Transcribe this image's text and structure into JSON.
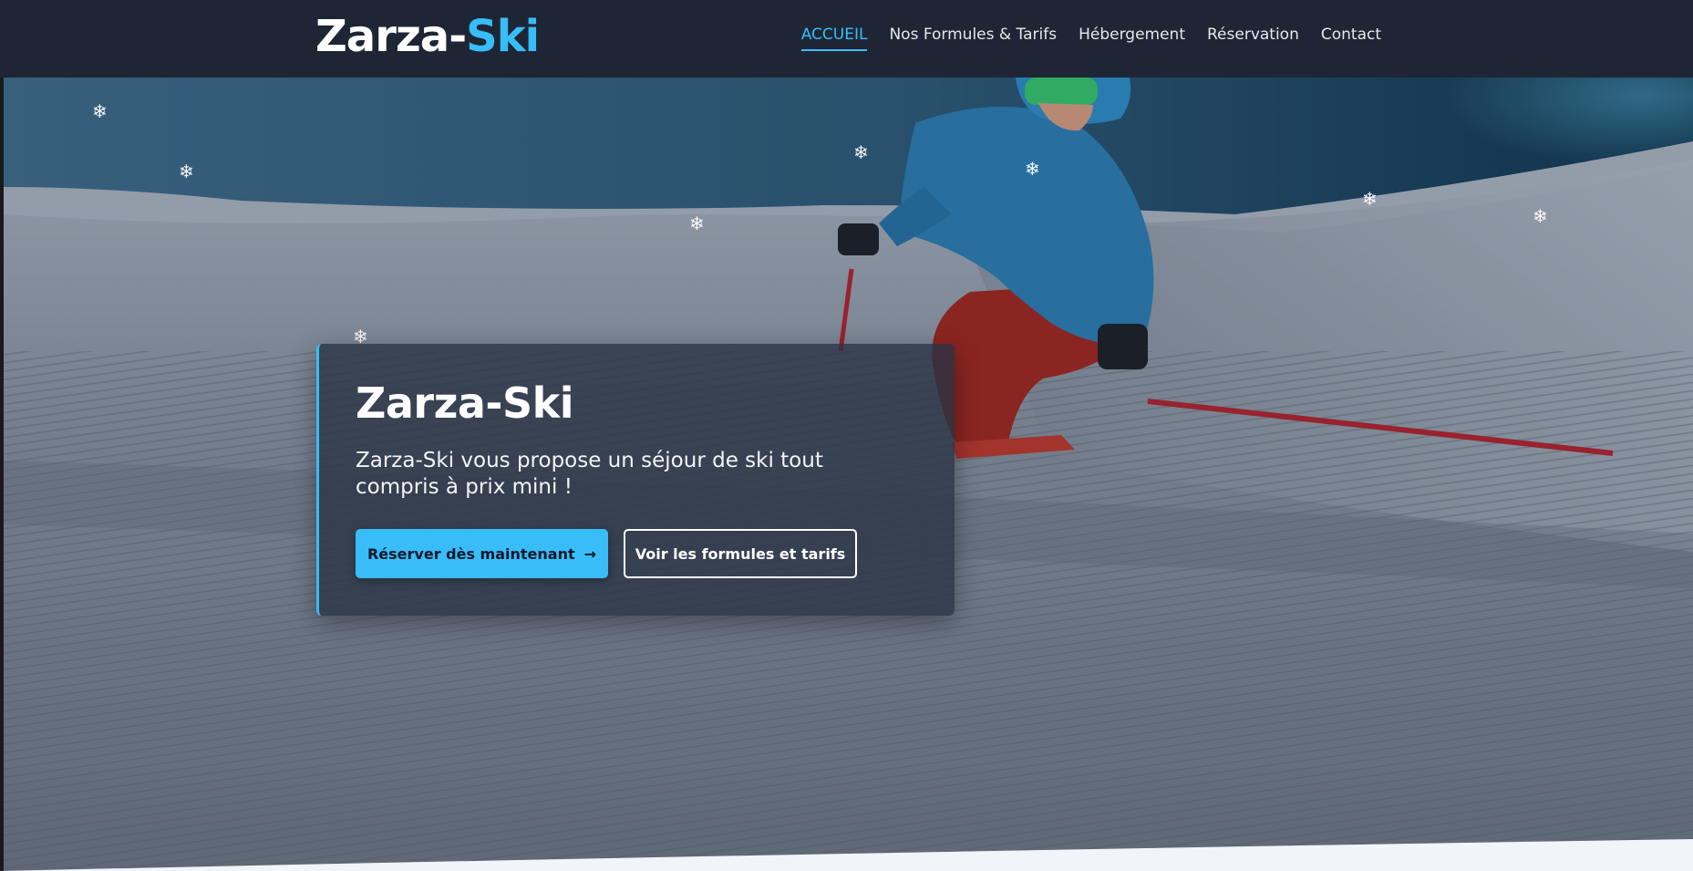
{
  "header": {
    "logo_main": "Zarza-",
    "logo_accent": "Ski",
    "nav": [
      {
        "label": "ACCUEIL",
        "active": true
      },
      {
        "label": "Nos Formules & Tarifs",
        "active": false
      },
      {
        "label": "Hébergement",
        "active": false
      },
      {
        "label": "Réservation",
        "active": false
      },
      {
        "label": "Contact",
        "active": false
      }
    ]
  },
  "hero": {
    "title": "Zarza-Ski",
    "subtitle": "Zarza-Ski vous propose un séjour de ski tout compris à prix mini !",
    "primary_button": "Réserver dès maintenant",
    "primary_button_icon": "→",
    "secondary_button": "Voir les formules et tarifs",
    "snowflake_glyph": "❄"
  },
  "colors": {
    "accent": "#38bdf8",
    "header_bg": "#1e2635",
    "card_bg": "#283242"
  }
}
